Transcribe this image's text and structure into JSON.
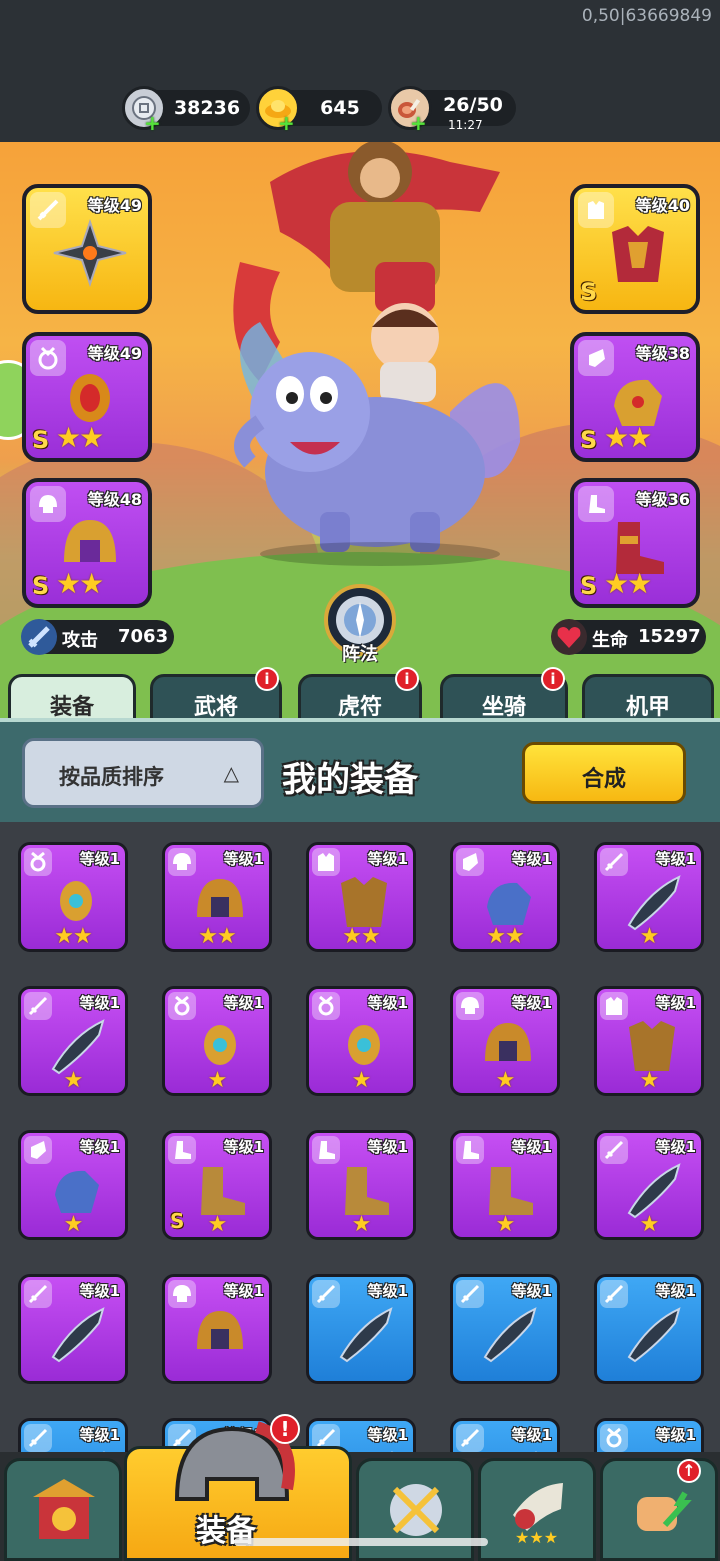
{
  "build_id": "0,50|63669849",
  "resources": {
    "silver": "38236",
    "gold": "645",
    "stamina": "26/50",
    "stamina_timer": "11:27",
    "plus": "+"
  },
  "equipped_left": [
    {
      "level": "等级49",
      "grade": "",
      "stars": "",
      "slot": "weapon",
      "color": "gold"
    },
    {
      "level": "等级49",
      "grade": "S",
      "stars": "★★",
      "slot": "medal",
      "color": "purple"
    },
    {
      "level": "等级48",
      "grade": "S",
      "stars": "★★",
      "slot": "helmet",
      "color": "purple"
    }
  ],
  "equipped_right": [
    {
      "level": "等级40",
      "grade": "S",
      "stars": "",
      "slot": "armor",
      "color": "gold"
    },
    {
      "level": "等级38",
      "grade": "S",
      "stars": "★★",
      "slot": "gauntlet",
      "color": "purple"
    },
    {
      "level": "等级36",
      "grade": "S",
      "stars": "★★",
      "slot": "boots",
      "color": "purple"
    }
  ],
  "stats": {
    "attack_label": "攻击",
    "attack_value": "7063",
    "hp_label": "生命",
    "hp_value": "15297"
  },
  "formation_label": "阵法",
  "tabs": [
    {
      "label": "装备",
      "active": true,
      "badge": ""
    },
    {
      "label": "武将",
      "active": false,
      "badge": "i"
    },
    {
      "label": "虎符",
      "active": false,
      "badge": "i"
    },
    {
      "label": "坐骑",
      "active": false,
      "badge": "i"
    },
    {
      "label": "机甲",
      "active": false,
      "badge": ""
    }
  ],
  "panel": {
    "sort_label": "按品质排序",
    "sort_arrow": "△",
    "title": "我的装备",
    "compose_label": "合成"
  },
  "inventory": [
    {
      "level": "等级1",
      "stars": "★★",
      "grade": "",
      "color": "purple",
      "slot": "medal"
    },
    {
      "level": "等级1",
      "stars": "★★",
      "grade": "",
      "color": "purple",
      "slot": "helmet"
    },
    {
      "level": "等级1",
      "stars": "★★",
      "grade": "",
      "color": "purple",
      "slot": "armor"
    },
    {
      "level": "等级1",
      "stars": "★★",
      "grade": "",
      "color": "purple",
      "slot": "gauntlet"
    },
    {
      "level": "等级1",
      "stars": "★",
      "grade": "",
      "color": "purple",
      "slot": "weapon"
    },
    {
      "level": "等级1",
      "stars": "★",
      "grade": "",
      "color": "purple",
      "slot": "weapon"
    },
    {
      "level": "等级1",
      "stars": "★",
      "grade": "",
      "color": "purple",
      "slot": "medal"
    },
    {
      "level": "等级1",
      "stars": "★",
      "grade": "",
      "color": "purple",
      "slot": "medal"
    },
    {
      "level": "等级1",
      "stars": "★",
      "grade": "",
      "color": "purple",
      "slot": "helmet"
    },
    {
      "level": "等级1",
      "stars": "★",
      "grade": "",
      "color": "purple",
      "slot": "armor"
    },
    {
      "level": "等级1",
      "stars": "★",
      "grade": "",
      "color": "purple",
      "slot": "gauntlet"
    },
    {
      "level": "等级1",
      "stars": "★",
      "grade": "S",
      "color": "purple",
      "slot": "boots"
    },
    {
      "level": "等级1",
      "stars": "★",
      "grade": "",
      "color": "purple",
      "slot": "boots"
    },
    {
      "level": "等级1",
      "stars": "★",
      "grade": "",
      "color": "purple",
      "slot": "boots"
    },
    {
      "level": "等级1",
      "stars": "★",
      "grade": "",
      "color": "purple",
      "slot": "weapon"
    },
    {
      "level": "等级1",
      "stars": "",
      "grade": "",
      "color": "purple",
      "slot": "weapon"
    },
    {
      "level": "等级1",
      "stars": "",
      "grade": "",
      "color": "purple",
      "slot": "helmet"
    },
    {
      "level": "等级1",
      "stars": "",
      "grade": "",
      "color": "blue",
      "slot": "weapon"
    },
    {
      "level": "等级1",
      "stars": "",
      "grade": "",
      "color": "blue",
      "slot": "weapon"
    },
    {
      "level": "等级1",
      "stars": "",
      "grade": "",
      "color": "blue",
      "slot": "weapon"
    },
    {
      "level": "等级1",
      "stars": "",
      "grade": "",
      "color": "blue",
      "slot": "weapon"
    },
    {
      "level": "等级1",
      "stars": "",
      "grade": "",
      "color": "blue",
      "slot": "weapon"
    },
    {
      "level": "等级1",
      "stars": "",
      "grade": "",
      "color": "blue",
      "slot": "weapon"
    },
    {
      "level": "等级1",
      "stars": "",
      "grade": "",
      "color": "blue",
      "slot": "weapon"
    },
    {
      "level": "等级1",
      "stars": "",
      "grade": "",
      "color": "blue",
      "slot": "medal"
    }
  ],
  "bottom_nav": {
    "items": [
      "city-gate-icon",
      "helmet-icon",
      "crossed-swords-icon",
      "horn-icon",
      "fist-upgrade-icon"
    ],
    "active_label": "装备",
    "alert": "!"
  },
  "colors": {
    "gold_card": "#f7c31c",
    "purple_card": "#b23fe8",
    "blue_card": "#2f95ea",
    "panel_teal": "#3d6a6c",
    "compose_yellow": "#ffd42a"
  }
}
